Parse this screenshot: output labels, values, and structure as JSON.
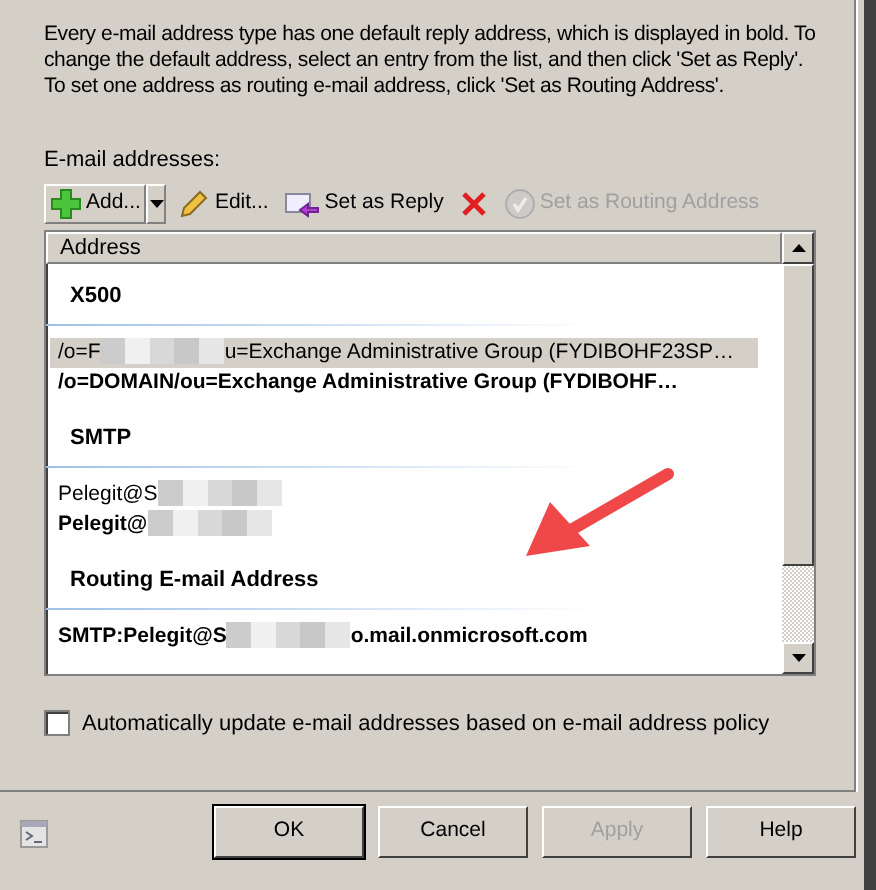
{
  "description": "Every e-mail address type has one default reply address, which is displayed in bold. To change the default address, select an entry from the list, and then click 'Set as Reply'. To set one address as routing e-mail address, click 'Set as Routing Address'.",
  "list_label": "E-mail addresses:",
  "toolbar": [
    {
      "kind": "add",
      "label": "Add...",
      "disabled": false
    },
    {
      "kind": "edit",
      "label": "Edit...",
      "disabled": false
    },
    {
      "kind": "reply",
      "label": "Set as Reply",
      "disabled": false
    },
    {
      "kind": "remove",
      "disabled": false
    },
    {
      "kind": "routing",
      "label": "Set as Routing Address",
      "disabled": true
    }
  ],
  "table": {
    "columns": [
      "Address"
    ],
    "rows": [
      {
        "kind": "group",
        "text": "X500"
      },
      {
        "kind": "entry",
        "prefix": "/o=F",
        "redacted": true,
        "suffix": "u=Exchange Administrative Group (FYDIBOHF23SP…",
        "bold": false,
        "selected": true
      },
      {
        "kind": "entry",
        "prefix": "/o=DOMAIN/ou=Exchange Administrative Group (FYDIBOHF…",
        "redacted": false,
        "bold": true,
        "selected": false
      },
      {
        "kind": "group",
        "text": "SMTP"
      },
      {
        "kind": "entry",
        "prefix": "Pelegit@S",
        "redacted": true,
        "bold": false,
        "selected": false
      },
      {
        "kind": "entry",
        "prefix": "Pelegit@",
        "redacted": true,
        "bold": true,
        "selected": false
      },
      {
        "kind": "group",
        "text": "Routing E-mail Address"
      },
      {
        "kind": "entry",
        "prefix": "SMTP:Pelegit@S",
        "redacted": true,
        "suffix": "o.mail.onmicrosoft.com",
        "bold": true,
        "selected": false
      }
    ]
  },
  "auto_update": {
    "label": "Automatically update e-mail addresses based on e-mail address policy",
    "checked": false
  },
  "buttons": [
    {
      "label": "OK",
      "default": true,
      "disabled": false
    },
    {
      "label": "Cancel",
      "default": false,
      "disabled": false
    },
    {
      "label": "Apply",
      "default": false,
      "disabled": true
    },
    {
      "label": "Help",
      "default": false,
      "disabled": false
    }
  ]
}
